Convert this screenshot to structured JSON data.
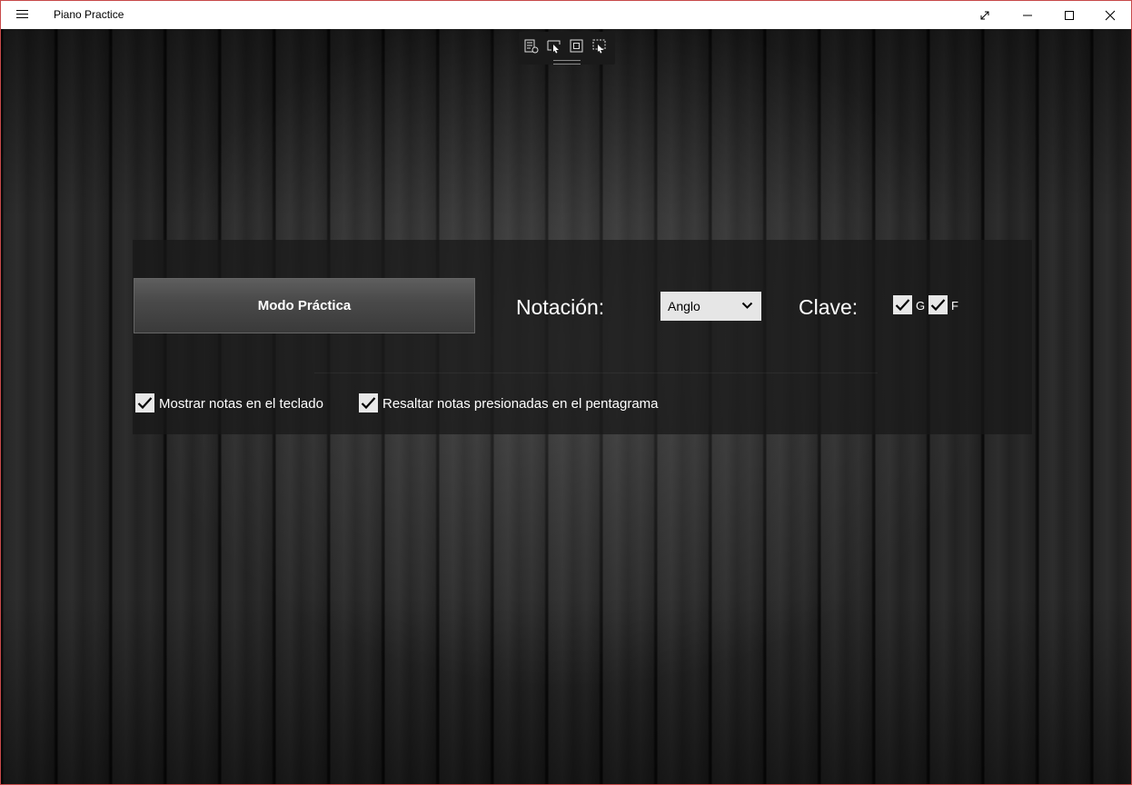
{
  "window": {
    "title": "Piano Practice"
  },
  "titlebar_icons": [
    "hamburger-menu-icon",
    "expand-icon",
    "minimize-icon",
    "maximize-icon",
    "close-icon"
  ],
  "debug_toolbar_icons": [
    "live-visual-tree-icon",
    "select-element-icon",
    "display-layout-adorners-icon",
    "track-focused-element-icon"
  ],
  "main": {
    "mode_button_label": "Modo Práctica",
    "notation_label": "Notación:",
    "notation_selected": "Anglo",
    "clef_label": "Clave:",
    "clef_g": {
      "label": "G",
      "checked": true
    },
    "clef_f": {
      "label": "F",
      "checked": true
    },
    "show_notes_keyboard": {
      "label": "Mostrar notas en el teclado",
      "checked": true
    },
    "highlight_pressed_notes": {
      "label": "Resaltar notas presionadas en el pentagrama",
      "checked": true
    }
  }
}
